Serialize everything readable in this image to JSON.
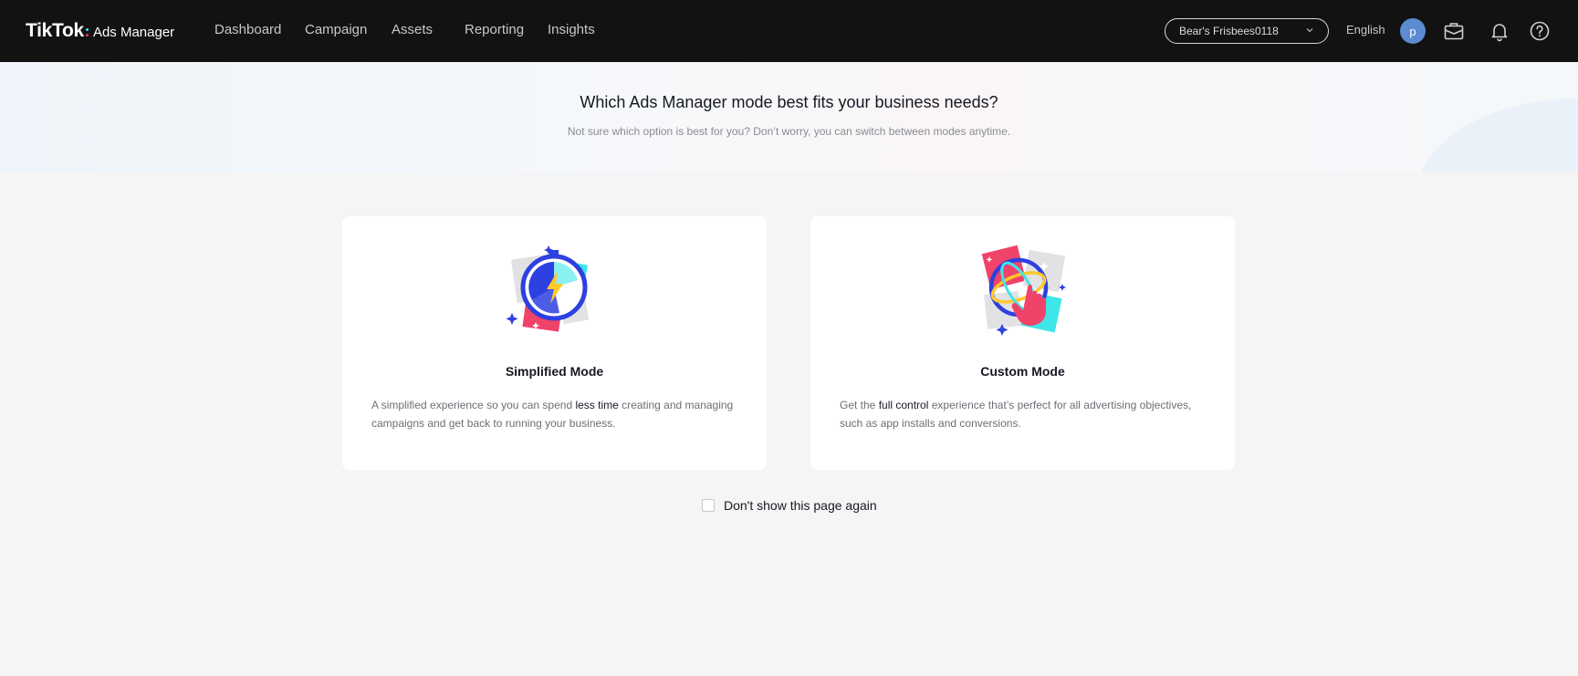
{
  "header": {
    "logo_brand": "TikTok",
    "logo_product": "Ads Manager",
    "nav": [
      {
        "label": "Dashboard"
      },
      {
        "label": "Campaign"
      },
      {
        "label": "Assets"
      },
      {
        "label": "Reporting"
      },
      {
        "label": "Insights"
      }
    ],
    "account_selector": "Bear's Frisbees0118",
    "language": "English",
    "avatar_initial": "p",
    "icons": [
      "chevron-down-icon",
      "briefcase-icon",
      "bell-icon",
      "help-icon"
    ]
  },
  "banner": {
    "title": "Which Ads Manager mode best fits your business needs?",
    "subtitle": "Not sure which option is best for you? Don’t worry, you can switch between modes anytime."
  },
  "modes": [
    {
      "title": "Simplified Mode",
      "desc_pre": "A simplified experience so you can spend ",
      "desc_bold": "less time",
      "desc_post": " creating and managing campaigns and get back to running your business.",
      "illustration": "stopwatch-lightning-icon"
    },
    {
      "title": "Custom Mode",
      "desc_pre": "Get the ",
      "desc_bold": "full control",
      "desc_post": " experience that’s perfect for all advertising objectives, such as app installs and conversions.",
      "illustration": "globe-hand-icon"
    }
  ],
  "dont_show": {
    "label": "Don't show this page again",
    "checked": false
  },
  "colors": {
    "topbar": "#121212",
    "page_bg": "#f5f5f5",
    "avatar": "#5b8bd0",
    "tiktok_red": "#fe2c55",
    "tiktok_cyan": "#25f4ee"
  }
}
